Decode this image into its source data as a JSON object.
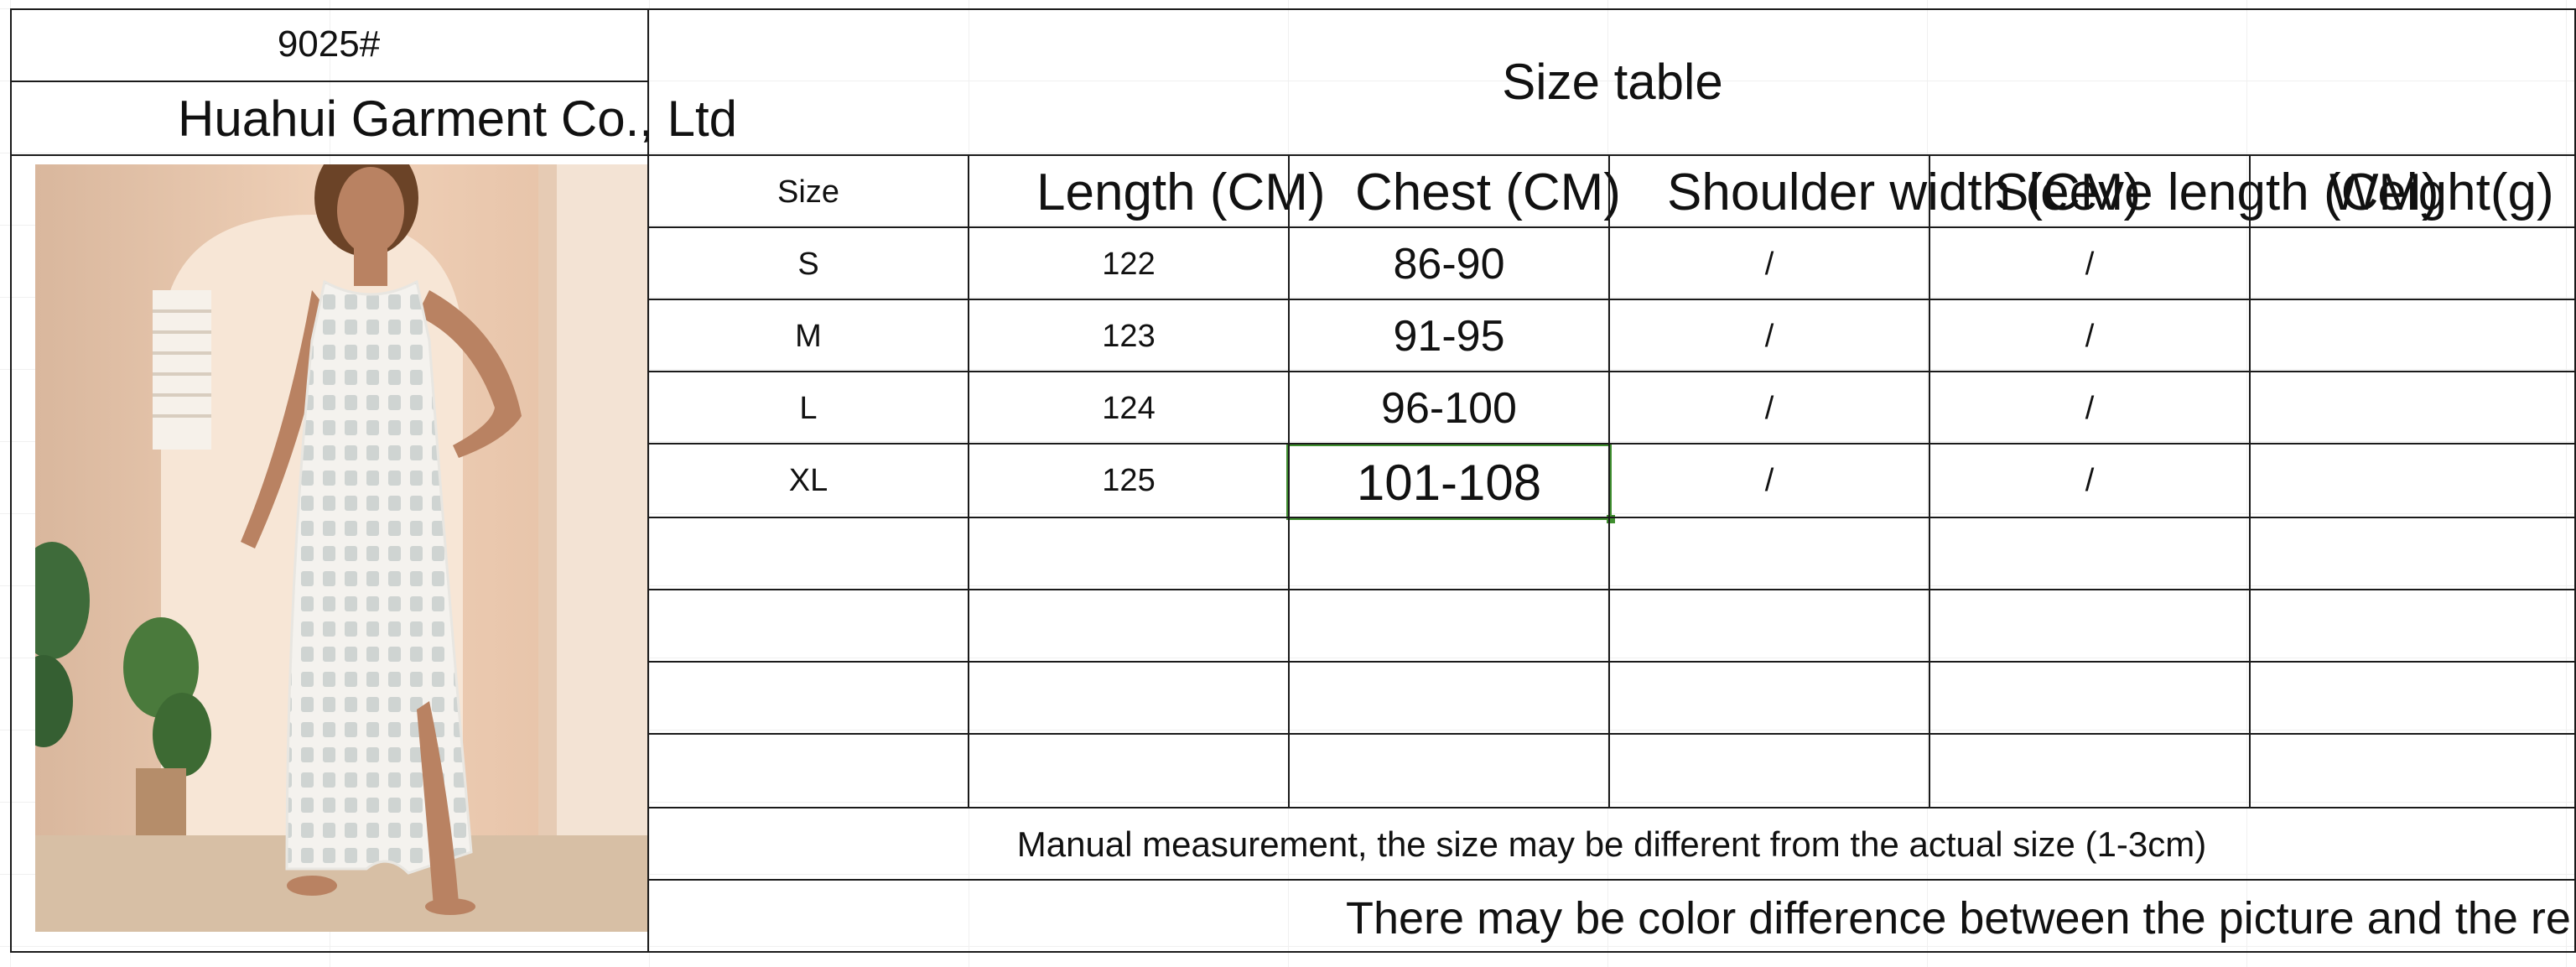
{
  "product": {
    "code": "9025#",
    "company": "Huahui Garment Co., Ltd",
    "image_alt": "Model wearing white sleeveless crochet knit maxi cover-up dress"
  },
  "table": {
    "title": "Size table",
    "headers": {
      "size": "Size",
      "length": "Length (CM)",
      "chest": "Chest (CM)",
      "shoulder": "Shoulder width (CM)",
      "sleeve": "Sleeve length (CM)",
      "weight": "Weight(g)"
    },
    "rows": [
      {
        "size": "S",
        "length": "122",
        "chest": "86-90",
        "shoulder": "/",
        "sleeve": "/",
        "weight": ""
      },
      {
        "size": "M",
        "length": "123",
        "chest": "91-95",
        "shoulder": "/",
        "sleeve": "/",
        "weight": ""
      },
      {
        "size": "L",
        "length": "124",
        "chest": "96-100",
        "shoulder": "/",
        "sleeve": "/",
        "weight": ""
      },
      {
        "size": "XL",
        "length": "125",
        "chest": "101-108",
        "shoulder": "/",
        "sleeve": "/",
        "weight": ""
      }
    ],
    "selected_cell": "XL / Chest (CM)"
  },
  "notes": {
    "measurement": "Manual measurement, the size may be different from the actual size (1-3cm)",
    "color": "There may be color difference between the picture and the real thing!!!"
  },
  "colors": {
    "selection": "#3f8f2f",
    "grid": "#1a1a1a"
  }
}
